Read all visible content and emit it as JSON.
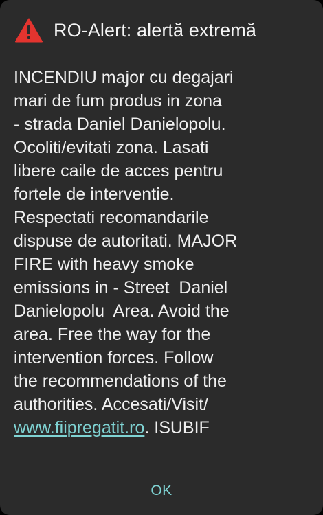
{
  "dialog": {
    "icon": "warning-triangle-icon",
    "icon_color": "#e3342f",
    "title": "RO-Alert: alertă extremă",
    "message_lines": [
      "INCENDIU major cu degajari",
      "mari de fum produs in zona",
      "- strada Daniel Danielopolu.",
      "Ocoliti/evitati zona. Lasati",
      "libere caile de acces pentru",
      "fortele de interventie.",
      "Respectati recomandarile",
      "dispuse de autoritati. MAJOR",
      "FIRE with heavy smoke",
      "emissions in - Street  Daniel",
      "Danielopolu  Area. Avoid the",
      "area. Free the way for the",
      "intervention forces. Follow",
      "the recommendations of the",
      "authorities. Accesati/Visit/"
    ],
    "link_text": "www.fiipregatit.ro",
    "after_link_text": ". ISUBIF",
    "link_color": "#7fd3d3",
    "ok_label": "OK"
  }
}
